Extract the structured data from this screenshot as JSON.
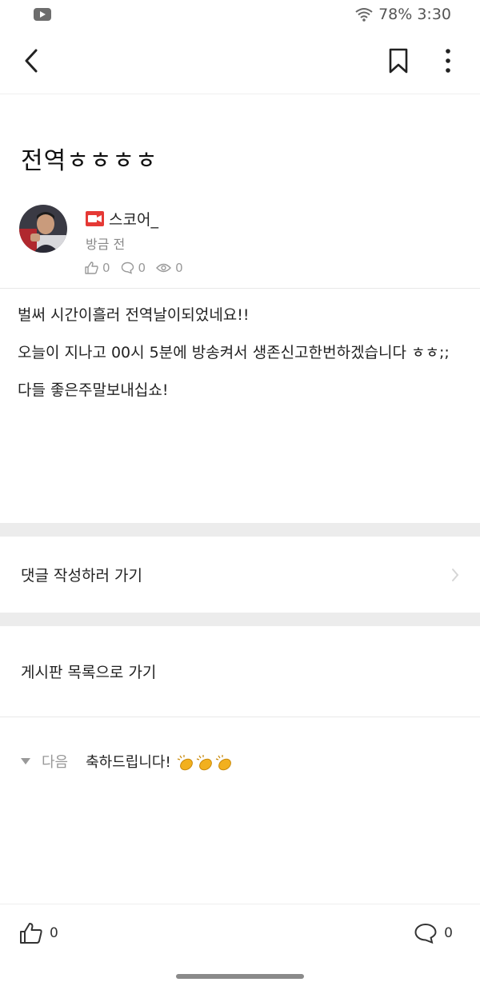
{
  "status_bar": {
    "battery": "78%",
    "time": "3:30"
  },
  "post": {
    "title": "전역ㅎㅎㅎㅎ",
    "author": "스코어_",
    "time_ago": "방금 전",
    "likes": "0",
    "comments": "0",
    "views": "0",
    "body": [
      "벌써 시간이흘러 전역날이되었네요!!",
      "오늘이 지나고 00시 5분에 방송켜서 생존신고한번하겠습니다 ㅎㅎ;;",
      "다들 좋은주말보내십쇼!"
    ]
  },
  "links": {
    "write_comment": "댓글 작성하러 가기",
    "board_list": "게시판 목록으로 가기"
  },
  "next_post": {
    "label": "다음",
    "title": "축하드립니다!"
  },
  "bottom_bar": {
    "like_count": "0",
    "comment_count": "0"
  },
  "icons": {
    "youtube": "youtube-icon",
    "wifi": "wifi-icon",
    "back": "chevron-left-icon",
    "bookmark": "bookmark-icon",
    "more": "more-vertical-icon",
    "camera": "camera-badge-icon",
    "like": "thumbs-up-icon",
    "comment": "comment-bubble-icon",
    "view": "eye-icon",
    "clap": "clap-icon"
  },
  "colors": {
    "camera_badge": "#e53935",
    "clap": "#f2b01e"
  }
}
